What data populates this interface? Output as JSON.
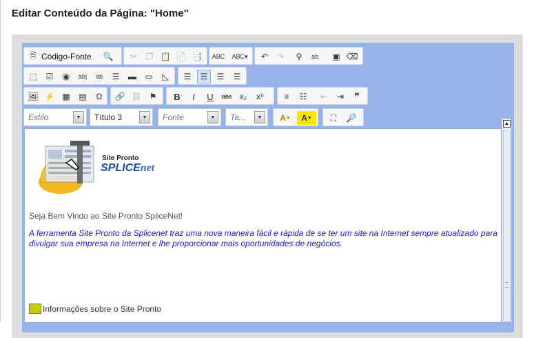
{
  "page": {
    "title": "Editar Conteúdo da Página: \"Home\""
  },
  "toolbar": {
    "source_label": "Código-Fonte",
    "style_combo": "Estilo",
    "format_combo": "Título 3",
    "font_combo": "Fonte",
    "size_combo": "Ta...",
    "bold": "B",
    "italic": "I",
    "underline": "U",
    "strike": "abc",
    "subscript": "x₂",
    "superscript": "x²",
    "quote": "❞",
    "text_color": "A",
    "bg_color": "A"
  },
  "logo": {
    "small": "Site Pronto",
    "brand": "SPLICE",
    "brand_suffix": "net"
  },
  "content": {
    "welcome": "Seja Bem Vindo ao Site Pronto SpliceNet!",
    "description": "A ferramenta Site Pronto da Splicenet traz uma nova maneira fácil e rápida de se ter um site na Internet sempre atualizado para divulgar sua empresa na Internet e lhe proporcionar mais oportunidades de negócios.",
    "info": "Informações sobre o Site Pronto"
  },
  "colors": {
    "editor_bg": "#97b4ea",
    "link_text": "#1b1bd0"
  }
}
